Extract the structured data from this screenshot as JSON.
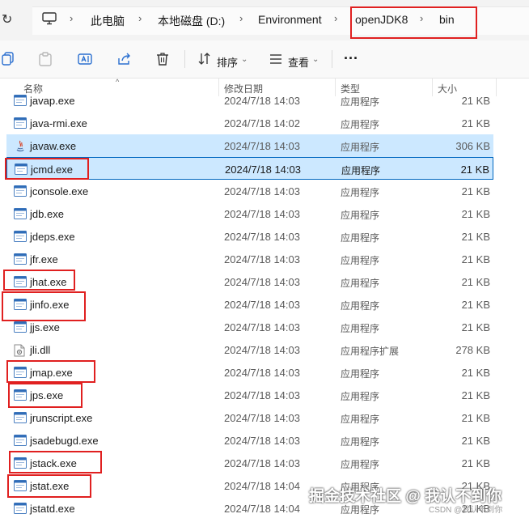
{
  "address_bar": {
    "breadcrumbs": [
      "此电脑",
      "本地磁盘 (D:)",
      "Environment",
      "openJDK8",
      "bin"
    ]
  },
  "toolbar": {
    "sort_label": "排序",
    "view_label": "查看",
    "more_label": "···"
  },
  "columns": {
    "name": "名称",
    "date": "修改日期",
    "type": "类型",
    "size": "大小"
  },
  "files": [
    {
      "name": "javap.exe",
      "date": "2024/7/18 14:03",
      "type": "应用程序",
      "size": "21 KB",
      "icon": "exe-icon"
    },
    {
      "name": "java-rmi.exe",
      "date": "2024/7/18 14:02",
      "type": "应用程序",
      "size": "21 KB",
      "icon": "exe-icon"
    },
    {
      "name": "javaw.exe",
      "date": "2024/7/18 14:03",
      "type": "应用程序",
      "size": "306 KB",
      "icon": "java-icon"
    },
    {
      "name": "jcmd.exe",
      "date": "2024/7/18 14:03",
      "type": "应用程序",
      "size": "21 KB",
      "icon": "exe-icon"
    },
    {
      "name": "jconsole.exe",
      "date": "2024/7/18 14:03",
      "type": "应用程序",
      "size": "21 KB",
      "icon": "exe-icon"
    },
    {
      "name": "jdb.exe",
      "date": "2024/7/18 14:03",
      "type": "应用程序",
      "size": "21 KB",
      "icon": "exe-icon"
    },
    {
      "name": "jdeps.exe",
      "date": "2024/7/18 14:03",
      "type": "应用程序",
      "size": "21 KB",
      "icon": "exe-icon"
    },
    {
      "name": "jfr.exe",
      "date": "2024/7/18 14:03",
      "type": "应用程序",
      "size": "21 KB",
      "icon": "exe-icon"
    },
    {
      "name": "jhat.exe",
      "date": "2024/7/18 14:03",
      "type": "应用程序",
      "size": "21 KB",
      "icon": "exe-icon"
    },
    {
      "name": "jinfo.exe",
      "date": "2024/7/18 14:03",
      "type": "应用程序",
      "size": "21 KB",
      "icon": "exe-icon"
    },
    {
      "name": "jjs.exe",
      "date": "2024/7/18 14:03",
      "type": "应用程序",
      "size": "21 KB",
      "icon": "exe-icon"
    },
    {
      "name": "jli.dll",
      "date": "2024/7/18 14:03",
      "type": "应用程序扩展",
      "size": "278 KB",
      "icon": "dll-icon"
    },
    {
      "name": "jmap.exe",
      "date": "2024/7/18 14:03",
      "type": "应用程序",
      "size": "21 KB",
      "icon": "exe-icon"
    },
    {
      "name": "jps.exe",
      "date": "2024/7/18 14:03",
      "type": "应用程序",
      "size": "21 KB",
      "icon": "exe-icon"
    },
    {
      "name": "jrunscript.exe",
      "date": "2024/7/18 14:03",
      "type": "应用程序",
      "size": "21 KB",
      "icon": "exe-icon"
    },
    {
      "name": "jsadebugd.exe",
      "date": "2024/7/18 14:03",
      "type": "应用程序",
      "size": "21 KB",
      "icon": "exe-icon"
    },
    {
      "name": "jstack.exe",
      "date": "2024/7/18 14:03",
      "type": "应用程序",
      "size": "21 KB",
      "icon": "exe-icon"
    },
    {
      "name": "jstat.exe",
      "date": "2024/7/18 14:04",
      "type": "应用程序",
      "size": "21 KB",
      "icon": "exe-icon"
    },
    {
      "name": "jstatd.exe",
      "date": "2024/7/18 14:04",
      "type": "应用程序",
      "size": "21 KB",
      "icon": "exe-icon"
    }
  ],
  "selected_file": "jcmd.exe",
  "hovered_file": "javaw.exe",
  "annotated_files": [
    "jcmd.exe",
    "jhat.exe",
    "jinfo.exe",
    "jmap.exe",
    "jps.exe",
    "jstack.exe",
    "jstat.exe"
  ],
  "watermark": {
    "text": "掘金技术社区 @ 我认不到你",
    "csdn": "CSDN @我认不到你"
  },
  "colors": {
    "selection": "#cce8ff",
    "selection_border": "#0067c0",
    "annotation_red": "#e02020"
  }
}
